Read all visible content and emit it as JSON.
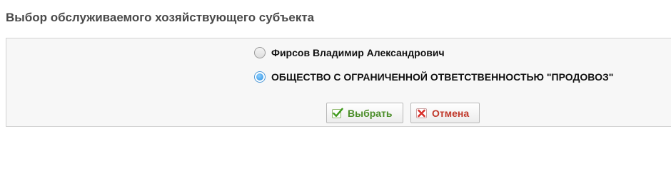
{
  "page": {
    "title": "Выбор обслуживаемого хозяйствующего субъекта"
  },
  "options": [
    {
      "label": "Фирсов Владимир Александрович",
      "selected": false
    },
    {
      "label": "ОБЩЕСТВО С ОГРАНИЧЕННОЙ ОТВЕТСТВЕННОСТЬЮ \"ПРОДОВОЗ\"",
      "selected": true
    }
  ],
  "buttons": {
    "select_label": "Выбрать",
    "select_icon": "checkmark-icon",
    "cancel_label": "Отмена",
    "cancel_icon": "close-icon"
  },
  "colors": {
    "select_text": "#4c8e2a",
    "cancel_text": "#c0392b",
    "radio_selected": "#2b8fe0",
    "panel_background": "#f7f7f7"
  }
}
